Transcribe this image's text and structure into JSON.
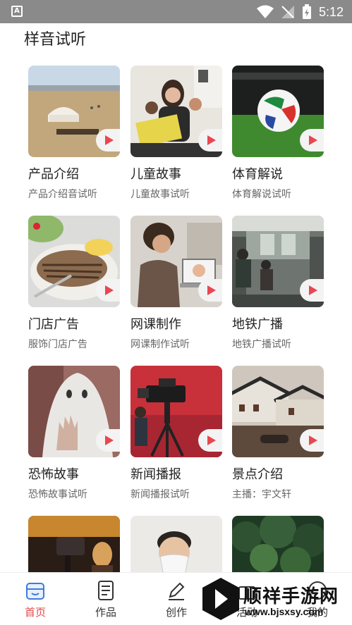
{
  "statusbar": {
    "time": "5:12",
    "app_icon": "A"
  },
  "section": {
    "title": "样音试听"
  },
  "cards": [
    {
      "title": "产品介绍",
      "subtitle": "产品介绍音试听",
      "image": "yurt-landscape"
    },
    {
      "title": "儿童故事",
      "subtitle": "儿童故事试听",
      "image": "mother-reading-to-kids"
    },
    {
      "title": "体育解说",
      "subtitle": "体育解说试听",
      "image": "soccer-ball"
    },
    {
      "title": "门店广告",
      "subtitle": "服饰门店广告",
      "image": "grilled-fish-dish"
    },
    {
      "title": "网课制作",
      "subtitle": "网课制作试听",
      "image": "online-class-laptop"
    },
    {
      "title": "地铁广播",
      "subtitle": "地铁广播试听",
      "image": "subway-train"
    },
    {
      "title": "恐怖故事",
      "subtitle": "恐怖故事试听",
      "image": "ghost-sheet"
    },
    {
      "title": "新闻播报",
      "subtitle": "新闻播报试听",
      "image": "news-camera"
    },
    {
      "title": "景点介绍",
      "subtitle": "主播：宇文轩",
      "image": "water-town"
    },
    {
      "title": "",
      "subtitle": "",
      "image": "studio-camera"
    },
    {
      "title": "",
      "subtitle": "",
      "image": "child-with-mask"
    },
    {
      "title": "",
      "subtitle": "",
      "image": "green-trees"
    }
  ],
  "tabs": [
    {
      "label": "首页",
      "icon": "home-icon",
      "active": true
    },
    {
      "label": "作品",
      "icon": "document-icon",
      "active": false
    },
    {
      "label": "创作",
      "icon": "pencil-icon",
      "active": false
    },
    {
      "label": "活动",
      "icon": "gift-icon",
      "active": false
    },
    {
      "label": "我的",
      "icon": "user-icon",
      "active": false
    }
  ],
  "watermark": {
    "text": "顺祥手游网",
    "url": "www.bjsxsy.com"
  },
  "colors": {
    "accent": "#e04a4a",
    "play": "#e8474f",
    "statusbar": "#8a8a8a"
  }
}
